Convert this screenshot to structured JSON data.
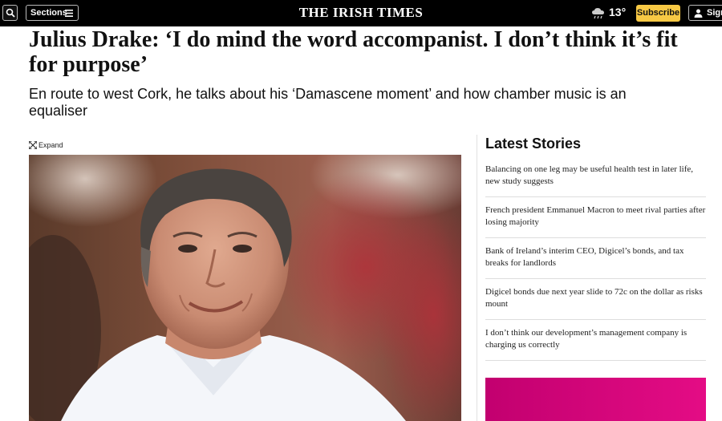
{
  "header": {
    "search_icon": "search-icon",
    "sections_label": "Sections",
    "menu_icon": "hamburger-menu-icon",
    "masthead": "THE IRISH TIMES",
    "weather_icon": "rain-cloud-icon",
    "temperature": "13°",
    "subscribe_label": "Subscribe",
    "user_icon": "user-icon",
    "sign_in_label": "Sign"
  },
  "article": {
    "headline": "Julius Drake: ‘I do mind the word accompanist. I don’t think it’s fit for purpose’",
    "standfirst": "En route to west Cork, he talks about his ‘Damascene moment’ and how chamber music is an equaliser",
    "expand_icon": "expand-icon",
    "expand_label": "Expand"
  },
  "sidebar": {
    "title": "Latest Stories",
    "stories": [
      {
        "text": "Balancing on one leg may be useful health test in later life, new study suggests"
      },
      {
        "text": "French president Emmanuel Macron to meet rival parties after losing majority"
      },
      {
        "text": "Bank of Ireland’s interim CEO, Digicel’s bonds, and tax breaks for landlords"
      },
      {
        "text": "Digicel bonds due next year slide to 72c on the dollar as risks mount"
      },
      {
        "text": "I don’t think our development’s management company is charging us correctly"
      }
    ]
  },
  "colors": {
    "topbar": "#000000",
    "subscribe": "#f7c844",
    "ad": "#d6007a"
  }
}
